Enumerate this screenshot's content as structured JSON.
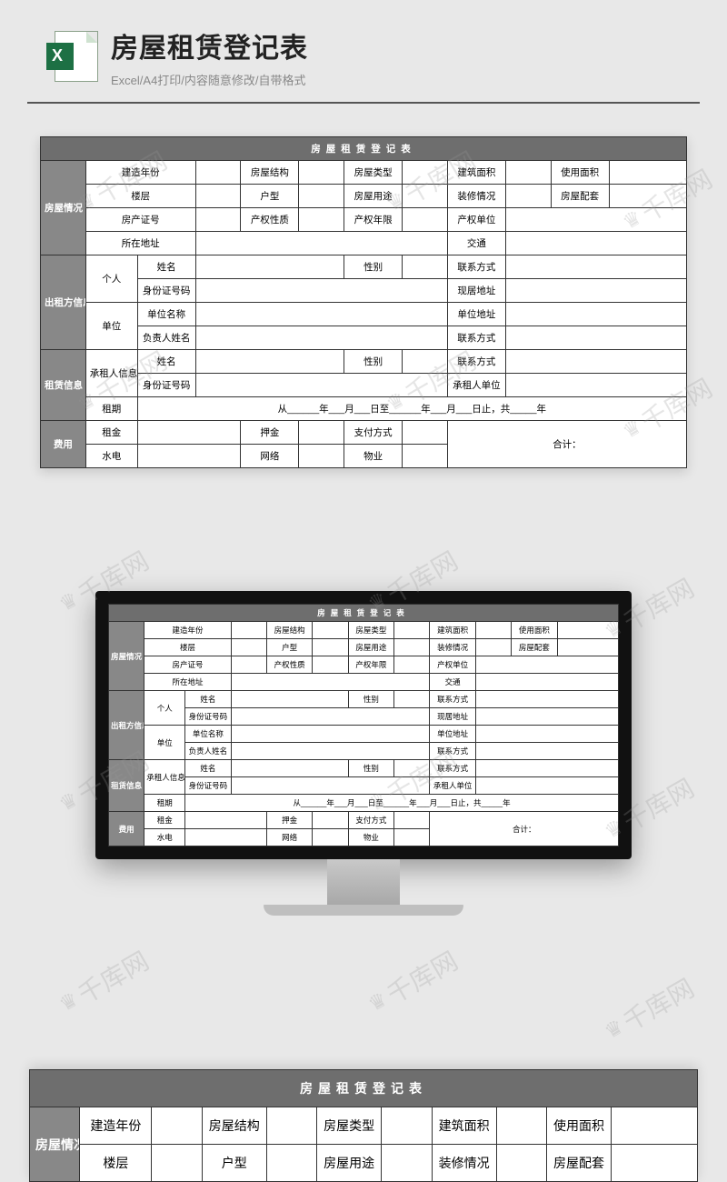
{
  "header": {
    "title": "房屋租赁登记表",
    "subtitle": "Excel/A4打印/内容随意修改/自带格式"
  },
  "watermark_text": "千库网",
  "form": {
    "table_title": "房屋租赁登记表",
    "sections": {
      "house": "房屋情况",
      "lessor": "出租方信息",
      "lessee": "租赁信息",
      "fee": "费用"
    },
    "labels": {
      "build_year": "建造年份",
      "structure": "房屋结构",
      "type": "房屋类型",
      "build_area": "建筑面积",
      "use_area": "使用面积",
      "floor": "楼层",
      "layout": "户型",
      "purpose": "房屋用途",
      "decoration": "装修情况",
      "facility": "房屋配套",
      "cert_no": "房产证号",
      "right_nature": "产权性质",
      "right_years": "产权年限",
      "right_unit": "产权单位",
      "address": "所在地址",
      "transport": "交通",
      "personal": "个人",
      "name": "姓名",
      "gender": "性别",
      "contact": "联系方式",
      "id_no": "身份证号码",
      "residence": "现居地址",
      "company": "单位",
      "company_name": "单位名称",
      "company_addr": "单位地址",
      "manager": "负责人姓名",
      "tenant_info": "承租人信息",
      "tenant_unit": "承租人单位",
      "term": "租期",
      "term_text": "从______年___月___日至______年___月___日止，共_____年",
      "rent": "租金",
      "deposit": "押金",
      "pay_method": "支付方式",
      "utilities": "水电",
      "network": "网络",
      "property": "物业",
      "total": "合计："
    }
  }
}
